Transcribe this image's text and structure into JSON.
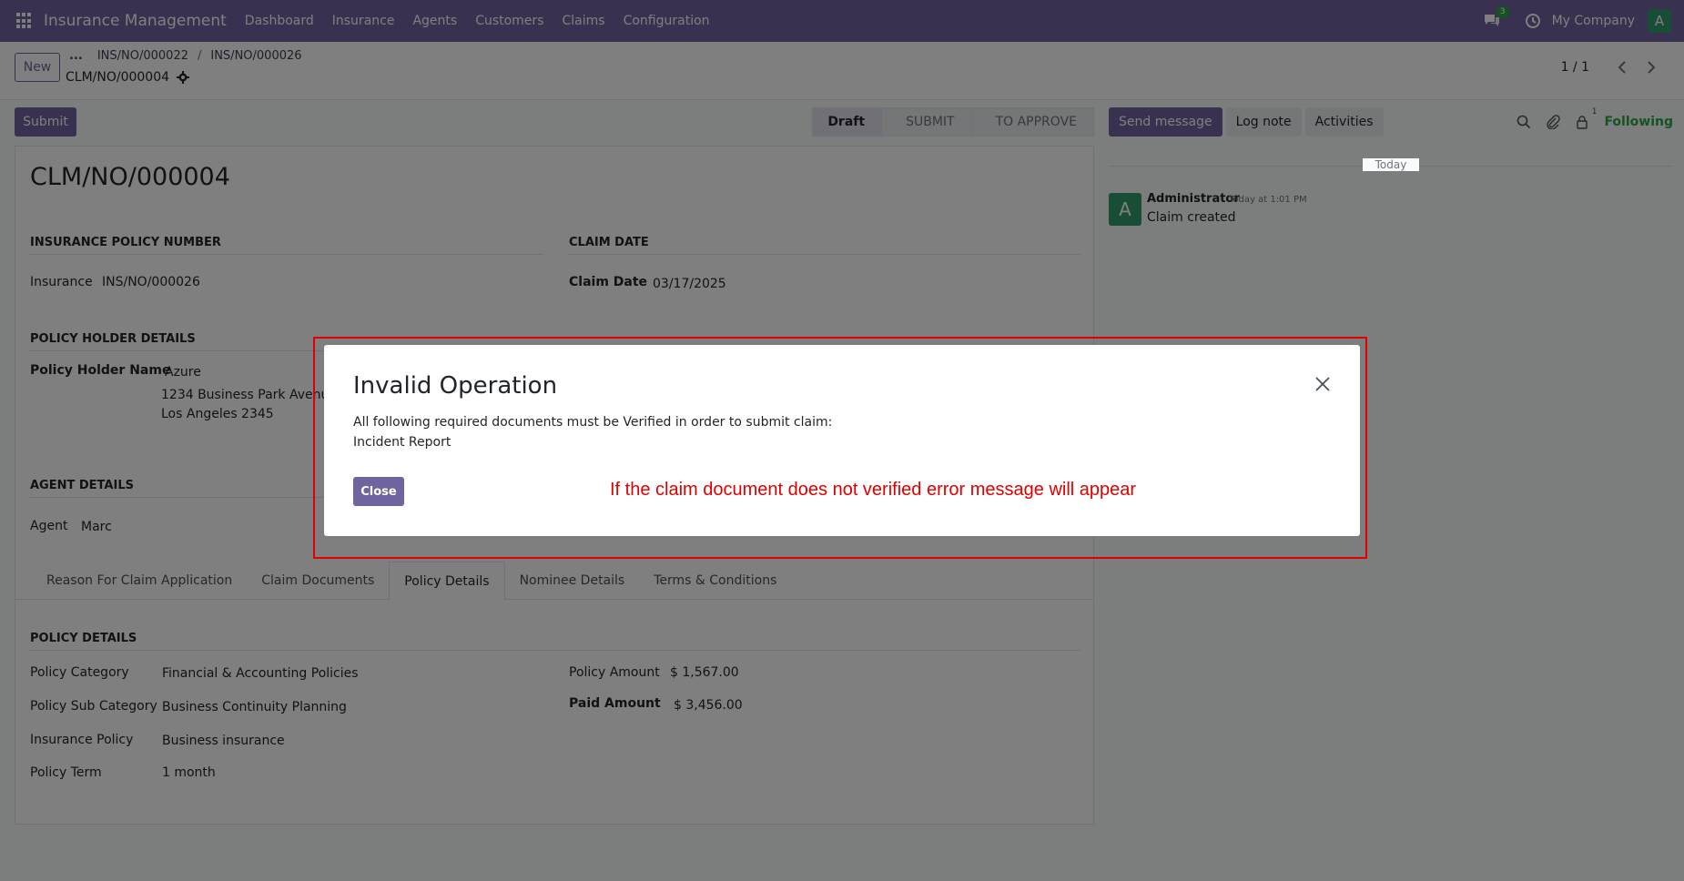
{
  "navbar": {
    "app_name": "Insurance Management",
    "menu": [
      "Dashboard",
      "Insurance",
      "Agents",
      "Customers",
      "Claims",
      "Configuration"
    ],
    "chat_badge": "3",
    "company": "My Company",
    "avatar_letter": "A"
  },
  "control": {
    "new_label": "New",
    "breadcrumb": [
      "...",
      "INS/NO/000022",
      "INS/NO/000026"
    ],
    "current_record": "CLM/NO/000004",
    "pager": "1 / 1"
  },
  "statusbar": {
    "submit_label": "Submit",
    "stages": [
      "Draft",
      "SUBMIT",
      "TO APPROVE"
    ],
    "active_stage": "Draft"
  },
  "form": {
    "title": "CLM/NO/000004",
    "insurance_section": "INSURANCE POLICY NUMBER",
    "insurance_label": "Insurance",
    "insurance_value": "INS/NO/000026",
    "claim_date_section": "CLAIM DATE",
    "claim_date_label": "Claim Date",
    "claim_date_value": "03/17/2025",
    "holder_section": "POLICY HOLDER DETAILS",
    "holder_label": "Policy Holder Name",
    "holder_name": "Azure",
    "holder_address_1": "1234 Business Park Avenue,",
    "holder_address_2": "Los Angeles 2345",
    "agent_section": "AGENT DETAILS",
    "agent_label": "Agent",
    "agent_value": "Marc",
    "tabs": [
      "Reason For Claim Application",
      "Claim Documents",
      "Policy Details",
      "Nominee Details",
      "Terms & Conditions"
    ],
    "active_tab": "Policy Details",
    "policy_section": "POLICY DETAILS",
    "policy_category_label": "Policy Category",
    "policy_category_value": "Financial & Accounting Policies",
    "policy_sub_category_label": "Policy Sub Category",
    "policy_sub_category_value": "Business Continuity Planning",
    "insurance_policy_label": "Insurance Policy",
    "insurance_policy_value": "Business insurance",
    "policy_term_label": "Policy Term",
    "policy_term_value": "1 month",
    "policy_amount_label": "Policy Amount",
    "policy_amount_value": "$ 1,567.00",
    "paid_amount_label": "Paid Amount",
    "paid_amount_value": "$ 3,456.00"
  },
  "chatter": {
    "send_message": "Send message",
    "log_note": "Log note",
    "activities": "Activities",
    "follower_count": "1",
    "following": "Following",
    "date_separator": "Today",
    "message": {
      "avatar_letter": "A",
      "author": "Administrator",
      "date": "Today at 1:01 PM",
      "body": "Claim created"
    }
  },
  "dialog": {
    "title": "Invalid Operation",
    "message_line_1": "All following required documents must be Verified in order to submit claim:",
    "message_line_2": "Incident Report",
    "close_label": "Close",
    "annotation": "If the claim document does not verified error message will appear",
    "annotation_color": "#e00000"
  },
  "colors": {
    "brand": "#71639e",
    "success": "#28a745",
    "avatar": "#2e9c6a"
  }
}
